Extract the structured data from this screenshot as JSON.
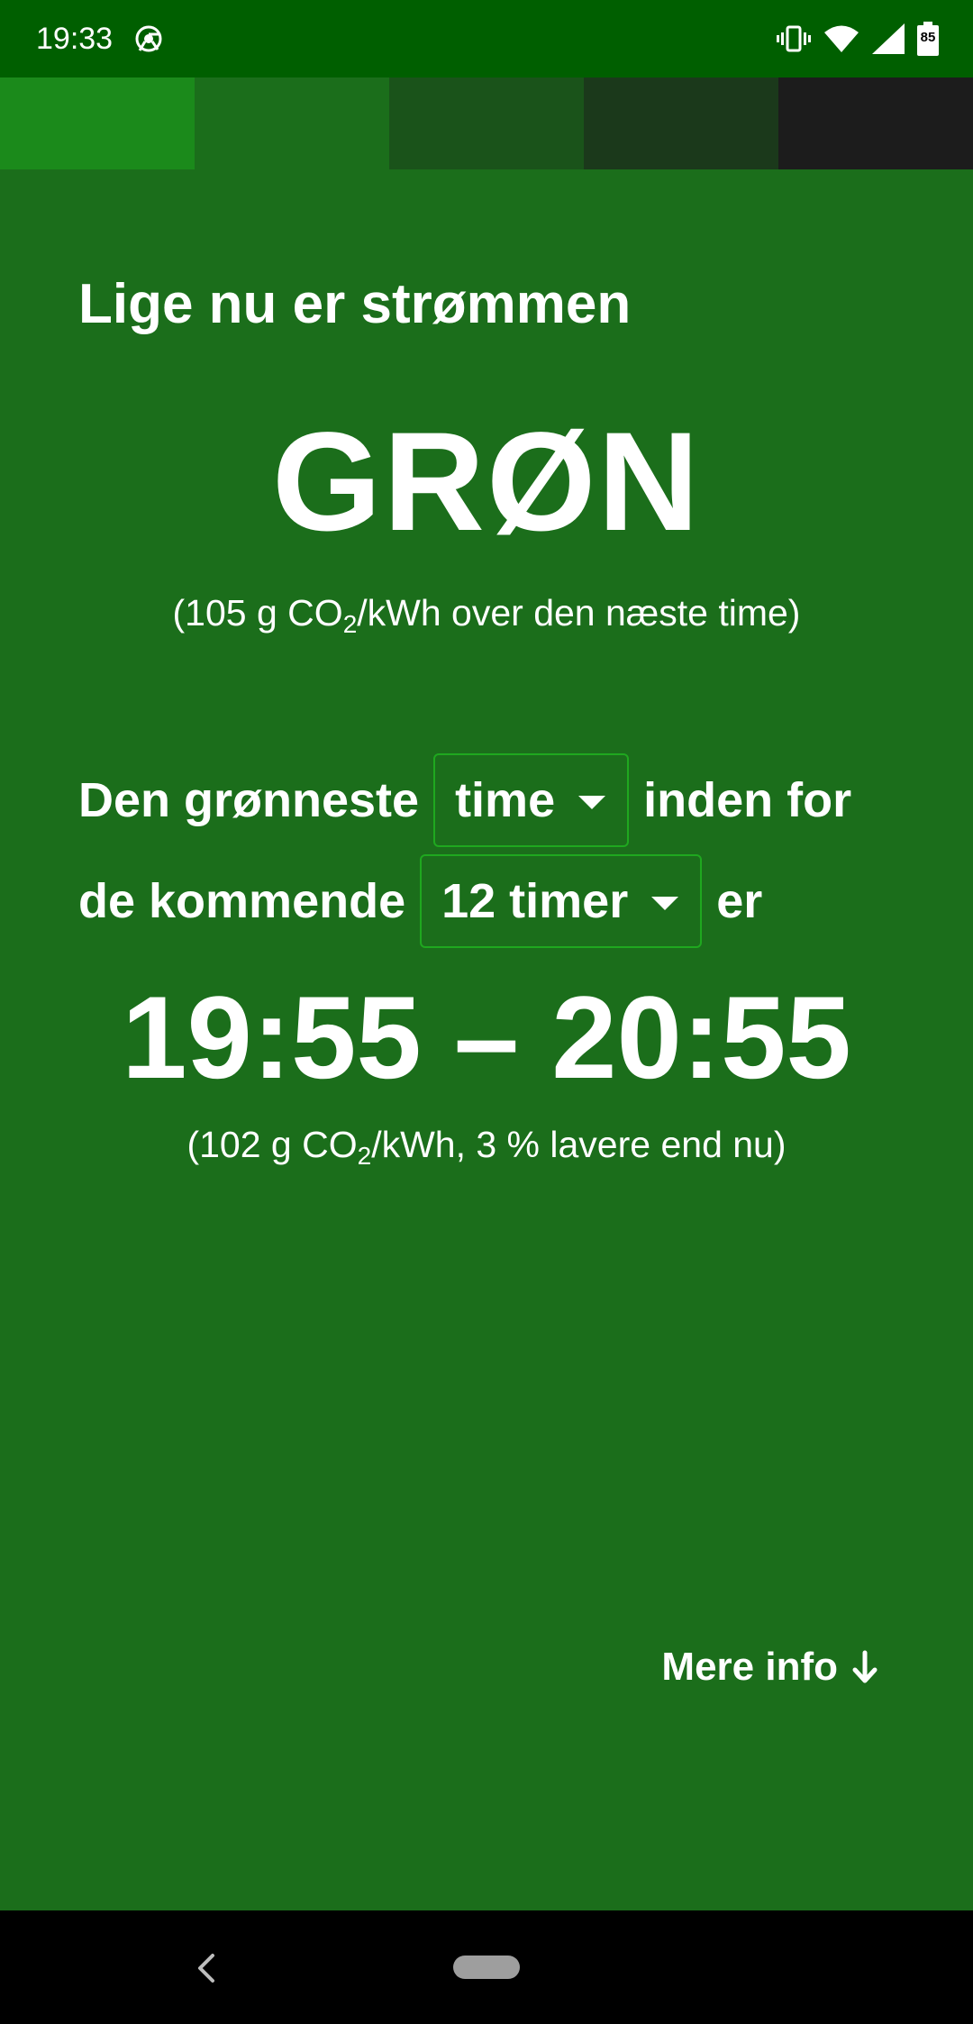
{
  "status_bar": {
    "time": "19:33",
    "battery_level": "85",
    "icons": [
      "chrome-icon",
      "vibrate-icon",
      "wifi-icon",
      "cellular-signal-icon",
      "battery-icon"
    ]
  },
  "scale": {
    "colors": [
      "#1b8a1b",
      "#1b6e1b",
      "#1a531a",
      "#1b391b",
      "#1c1c1c"
    ],
    "current_index": 1
  },
  "intro": "Lige nu er strømmen",
  "status_word": "GRØN",
  "current": {
    "prefix": "(105 g CO",
    "subscript": "2",
    "suffix": "/kWh over den næste time)"
  },
  "sentence": {
    "part1": "Den grønneste",
    "duration_value": "time",
    "part2": "inden for",
    "part3": "de kommende",
    "window_value": "12 timer",
    "part4": "er"
  },
  "best_window": "19:55 – 20:55",
  "best": {
    "prefix": "(102 g CO",
    "subscript": "2",
    "suffix": "/kWh, 3 % lavere end nu)"
  },
  "more_info_label": "Mere info",
  "colors": {
    "background": "#1b6e1b",
    "status_bar": "#005f00",
    "dropdown_border": "#1fa81f",
    "nav_bar": "#000000"
  }
}
